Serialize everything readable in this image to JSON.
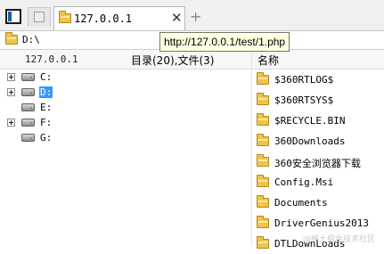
{
  "tabs": {
    "active_label": "127.0.0.1",
    "close_glyph": "✕",
    "new_tab_glyph": "+"
  },
  "address": {
    "path": "D:\\"
  },
  "tooltip": {
    "text": "http://127.0.0.1/test/1.php"
  },
  "header": {
    "host": "127.0.0.1",
    "count": "目录(20),文件(3)",
    "name_column": "名称"
  },
  "tree": {
    "drives": [
      {
        "label": "C:",
        "expandable": true,
        "selected": false
      },
      {
        "label": "D:",
        "expandable": true,
        "selected": true
      },
      {
        "label": "E:",
        "expandable": false,
        "selected": false
      },
      {
        "label": "F:",
        "expandable": true,
        "selected": false
      },
      {
        "label": "G:",
        "expandable": false,
        "selected": false
      }
    ]
  },
  "files": [
    {
      "name": "$360RTLOG$",
      "icon": "folder-icon"
    },
    {
      "name": "$360RTSYS$",
      "icon": "folder-icon"
    },
    {
      "name": "$RECYCLE.BIN",
      "icon": "folder-icon"
    },
    {
      "name": "360Downloads",
      "icon": "folder-icon"
    },
    {
      "name": "360安全浏览器下载",
      "icon": "folder-icon"
    },
    {
      "name": "Config.Msi",
      "icon": "folder-icon"
    },
    {
      "name": "Documents",
      "icon": "folder-icon"
    },
    {
      "name": "DriverGenius2013",
      "icon": "folder-icon"
    },
    {
      "name": "DTLDownLoads",
      "icon": "folder-icon"
    }
  ],
  "watermark": "@稀土掘金技术社区",
  "colors": {
    "selection": "#3399ff",
    "folder": "#f0c34a",
    "tooltip_bg": "#ffffe1"
  }
}
